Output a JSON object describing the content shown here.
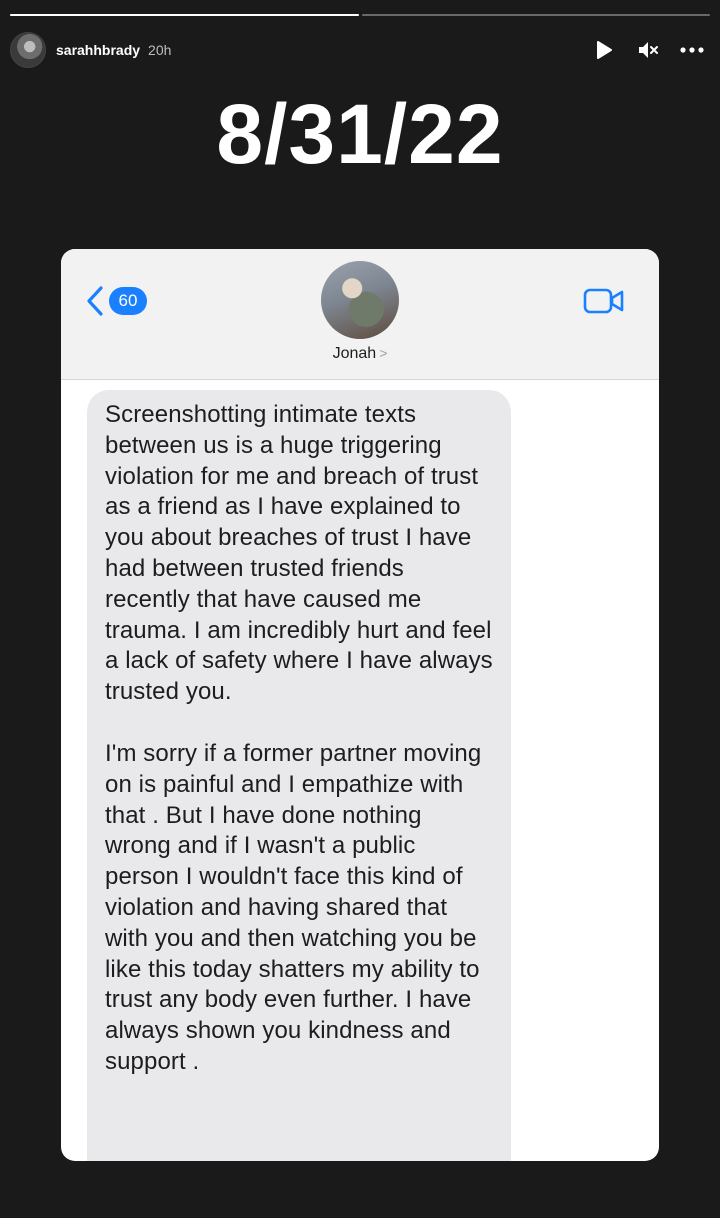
{
  "story": {
    "segments_total": 2,
    "segment_progress": [
      1.0,
      0.0
    ],
    "username": "sarahhbrady",
    "time_ago": "20h",
    "controls": {
      "play_icon": "play-icon",
      "mute_icon": "speaker-muted-icon",
      "more_icon": "more-horizontal-icon"
    }
  },
  "date_text": "8/31/22",
  "imessage": {
    "unread_count": "60",
    "contact_name": "Jonah",
    "contact_chevron": ">",
    "accent_color": "#1a80ff",
    "bubble_paragraphs": [
      "Screenshotting intimate texts between us is a huge triggering violation for me and breach of trust as a friend as I have explained to you about breaches of trust I have had between trusted friends recently that have caused me trauma. I am incredibly hurt and feel a lack of safety where I have always trusted you.",
      "I'm sorry if a former partner moving on is painful and I empathize with that . But I have done nothing wrong and if I wasn't a public person I wouldn't face this kind of violation and having shared that with you and then watching you be like this today shatters my ability to trust any body even further. I have always shown you kindness and support ."
    ]
  }
}
